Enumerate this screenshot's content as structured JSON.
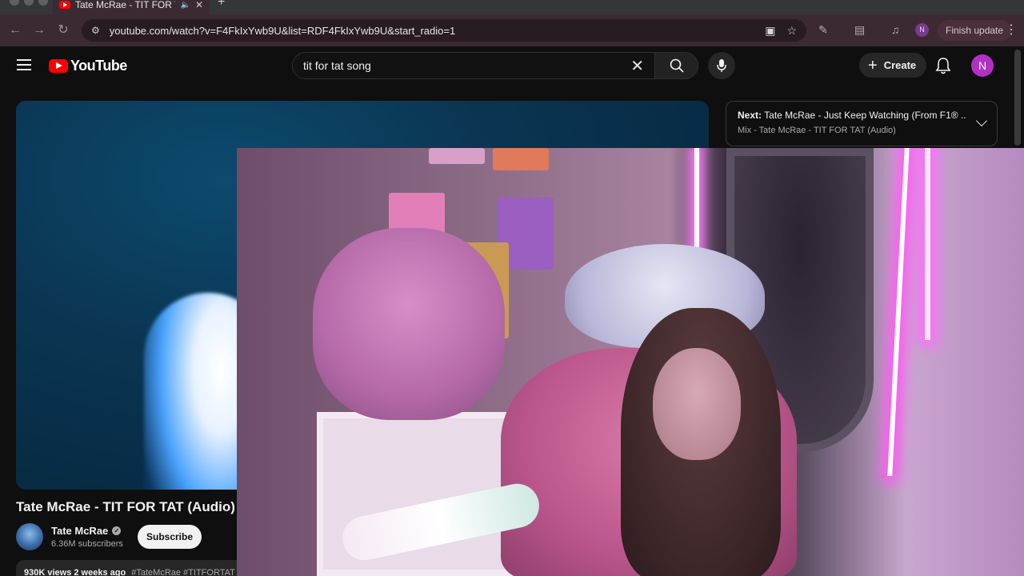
{
  "browser": {
    "tab_title": "Tate McRae - TIT FOR TAT",
    "url": "youtube.com/watch?v=F4FkIxYwb9U&list=RDF4FkIxYwb9U&start_radio=1",
    "profile_initial": "N",
    "finish_update_label": "Finish update"
  },
  "masthead": {
    "logo_text": "YouTube",
    "search_query": "tit for tat song",
    "create_label": "Create",
    "avatar_initial": "N"
  },
  "up_next": {
    "prefix": "Next:",
    "title": "Tate McRae - Just Keep Watching (From F1® ...",
    "playlist": "Mix - Tate McRae - TIT FOR TAT (Audio)"
  },
  "video": {
    "title": "Tate McRae - TIT FOR TAT (Audio)",
    "channel": "Tate McRae",
    "subscribers": "6.36M subscribers",
    "subscribe_label": "Subscribe",
    "meta": "930K views  2 weeks ago",
    "tags": "#TateMcRae #TITFORTAT"
  },
  "colors": {
    "yt_red": "#ff0000",
    "avatar_purple": "#b330c4",
    "chrome_bar": "#3c2a33"
  }
}
